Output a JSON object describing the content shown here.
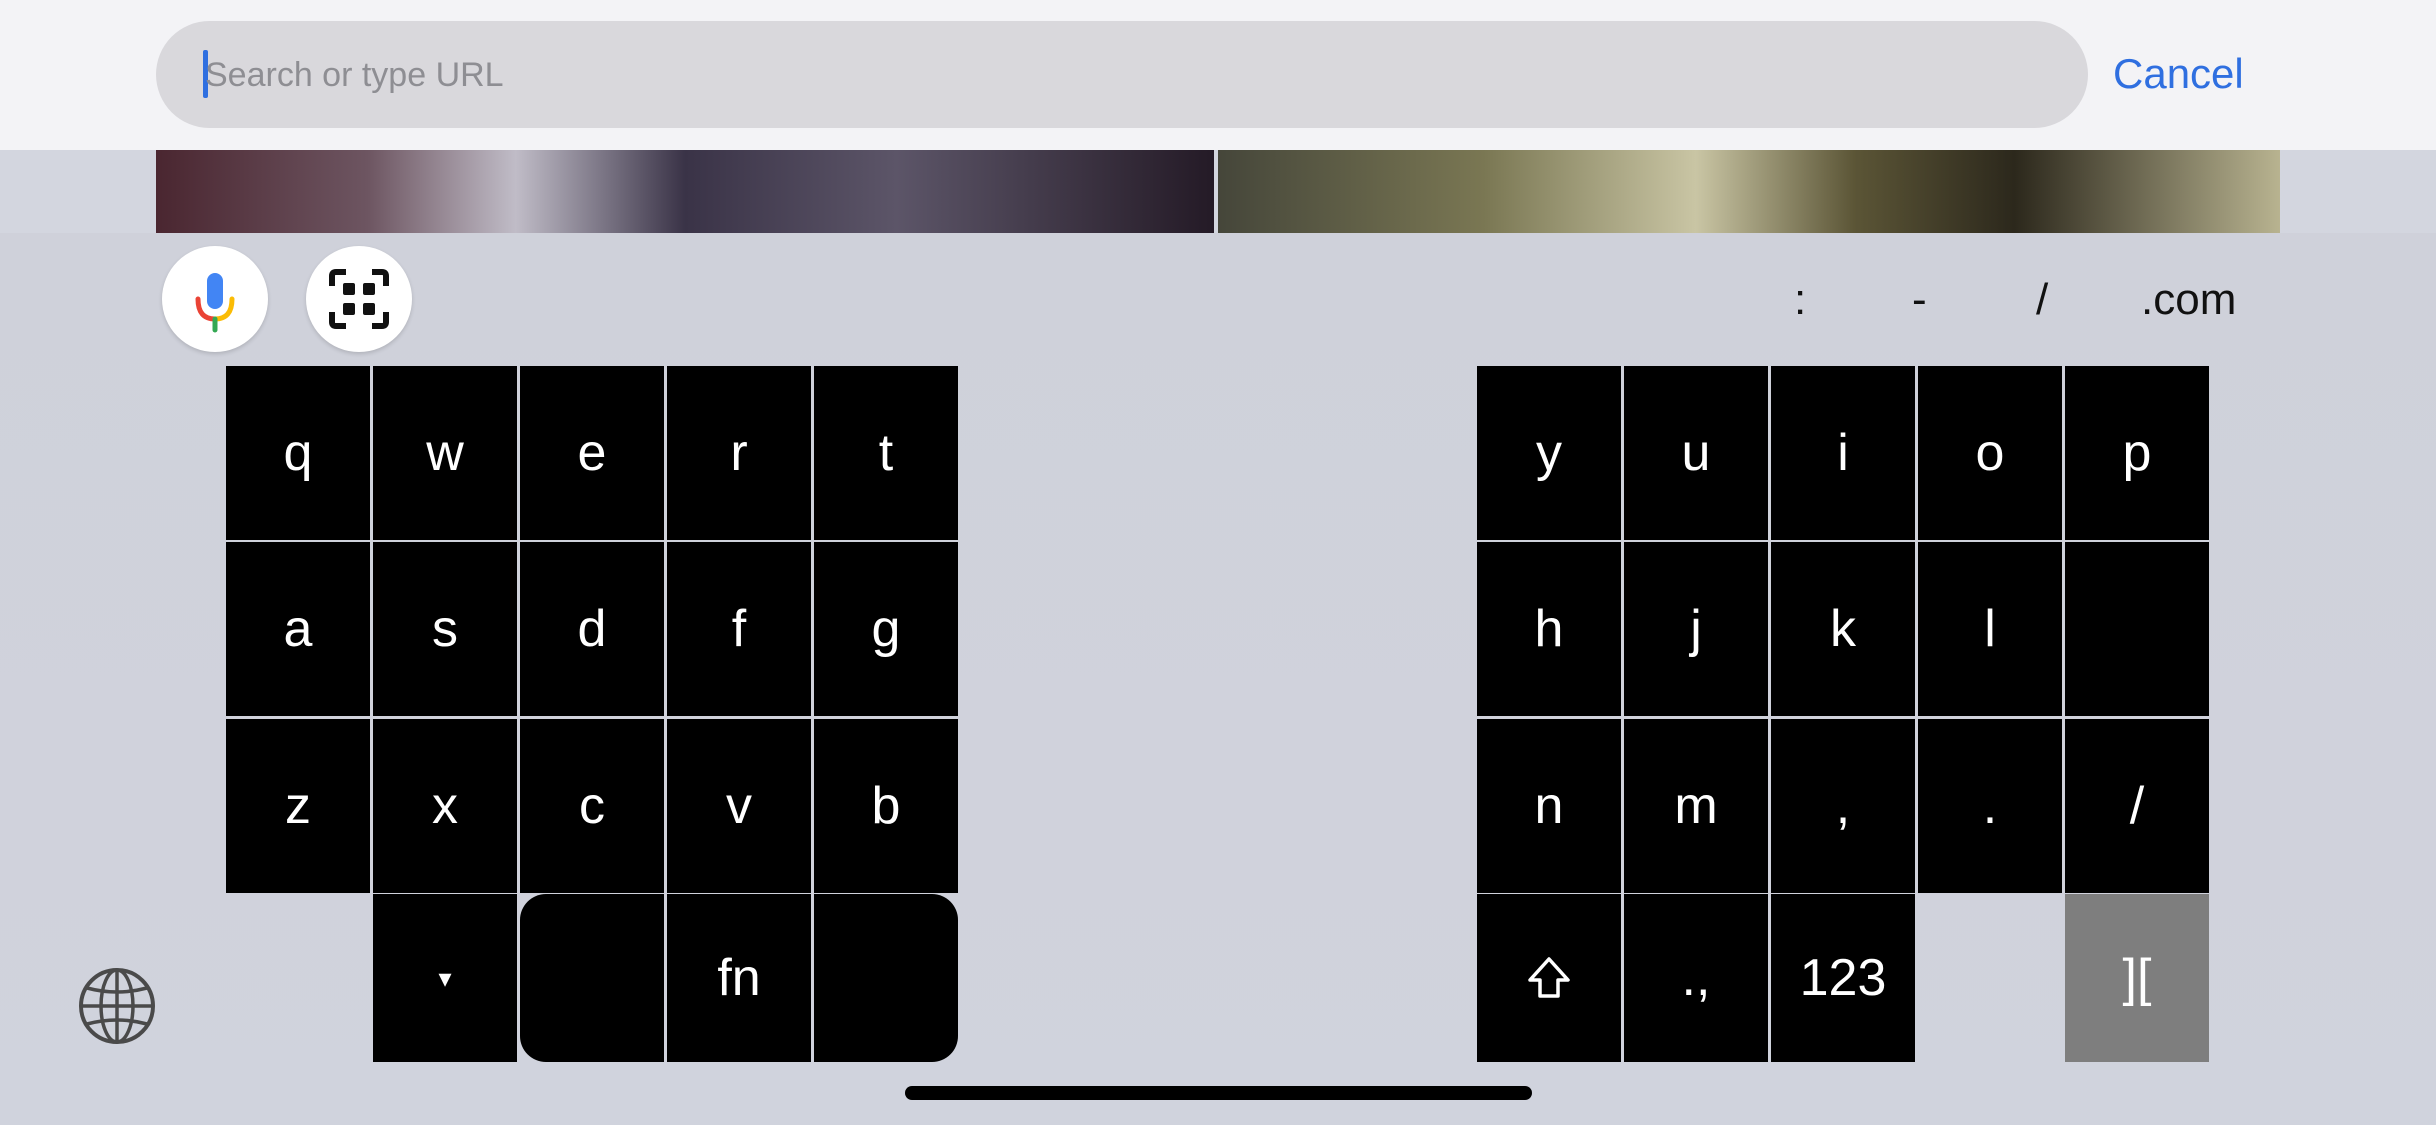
{
  "addressBar": {
    "placeholder": "Search or type URL",
    "cancel_label": "Cancel"
  },
  "accessory": {
    "suggestions": [
      ":",
      "-",
      "/",
      ".com"
    ]
  },
  "keyboard": {
    "left": [
      [
        "q",
        "w",
        "e",
        "r",
        "t"
      ],
      [
        "a",
        "s",
        "d",
        "f",
        "g"
      ],
      [
        "z",
        "x",
        "c",
        "v",
        "b"
      ]
    ],
    "right": [
      [
        "y",
        "u",
        "i",
        "o",
        "p"
      ],
      [
        "h",
        "j",
        "k",
        "l",
        ""
      ],
      [
        "n",
        "m",
        ",",
        ".",
        "/"
      ]
    ],
    "left_bottom": [
      "▾",
      "",
      "fn",
      ""
    ],
    "right_bottom": [
      "⇧",
      ".,",
      "123",
      "",
      "]["
    ]
  },
  "colors": {
    "accent": "#2f6fe0",
    "key_bg": "#000000",
    "special_key_bg": "#7e7e7e",
    "keyboard_bg": "#d0d3dd"
  }
}
